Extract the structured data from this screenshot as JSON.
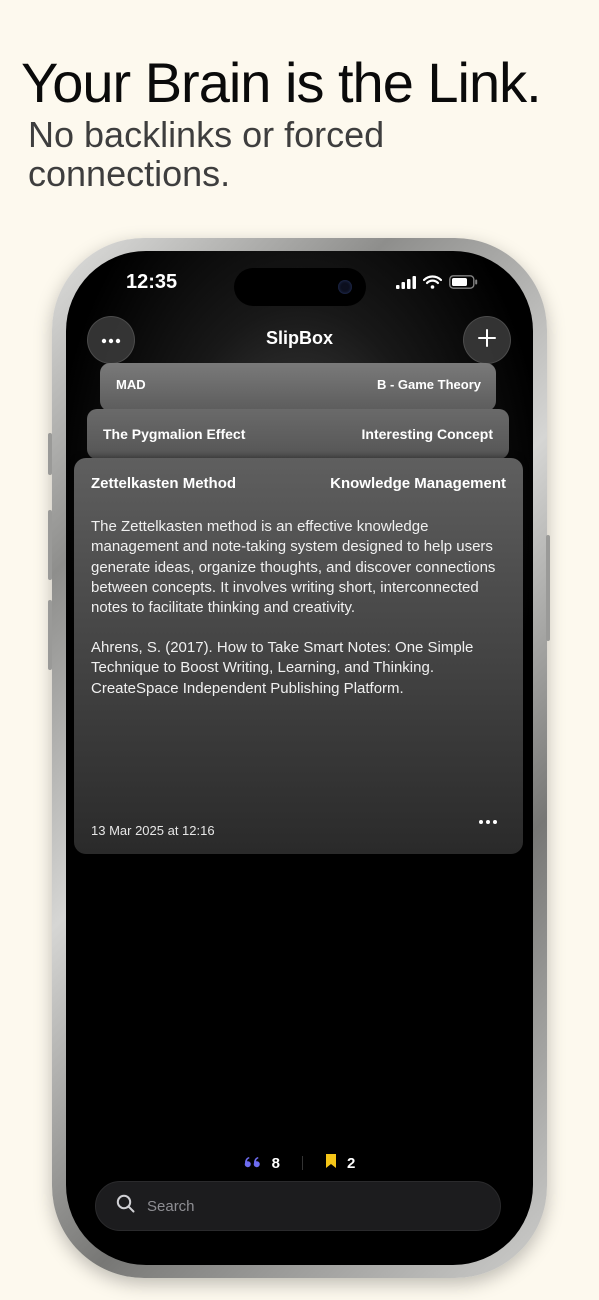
{
  "headline": "Your Brain is the Link.",
  "subheadline": "No backlinks or forced connections.",
  "status_bar": {
    "time": "12:35"
  },
  "nav": {
    "title": "SlipBox"
  },
  "background_cards": [
    {
      "title": "MAD",
      "tag": "B - Game Theory"
    },
    {
      "title": "The Pygmalion Effect",
      "tag": "Interesting Concept"
    }
  ],
  "note": {
    "title": "Zettelkasten Method",
    "tag": "Knowledge Management",
    "body": "The Zettelkasten method is an effective knowledge management and note-taking system designed to help users generate ideas, organize thoughts, and discover connections between concepts. It involves writing short, interconnected notes to facilitate thinking and creativity.",
    "reference": "Ahrens, S. (2017). How to Take Smart Notes: One Simple Technique to Boost Writing, Learning, and Thinking. CreateSpace Independent Publishing Platform.",
    "date": "13 Mar 2025 at 12:16"
  },
  "counts": {
    "quotes": "8",
    "bookmarks": "2"
  },
  "search": {
    "placeholder": "Search"
  },
  "colors": {
    "page_background": "#fdf9ee",
    "quote_icon": "#6e6cf0",
    "bookmark_icon": "#f5c518"
  },
  "icons": [
    "ellipsis-icon",
    "plus-icon",
    "quote-icon",
    "bookmark-icon",
    "search-icon",
    "signal-icon",
    "wifi-icon",
    "battery-icon"
  ]
}
